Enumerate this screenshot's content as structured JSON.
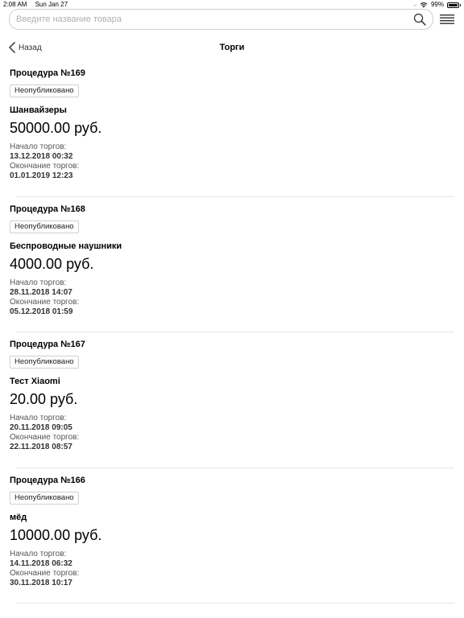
{
  "status_bar": {
    "time": "2:08 AM",
    "date": "Sun Jan 27",
    "battery": "99%",
    "signal": "....."
  },
  "search": {
    "placeholder": "Введите название товара"
  },
  "nav": {
    "back_label": "Назад",
    "title": "Торги"
  },
  "labels": {
    "start": "Начало торгов:",
    "end": "Окончание торгов:"
  },
  "procedures": [
    {
      "title": "Процедура №169",
      "status": "Неопубликовано",
      "product": "Шанвайзеры",
      "price": "50000.00 руб.",
      "start": "13.12.2018 00:32",
      "end": "01.01.2019 12:23"
    },
    {
      "title": "Процедура №168",
      "status": "Неопубликовано",
      "product": "Беспроводные наушники",
      "price": "4000.00 руб.",
      "start": "28.11.2018 14:07",
      "end": "05.12.2018 01:59"
    },
    {
      "title": "Процедура №167",
      "status": "Неопубликовано",
      "product": "Тест Xiaomi",
      "price": "20.00 руб.",
      "start": "20.11.2018 09:05",
      "end": "22.11.2018 08:57"
    },
    {
      "title": "Процедура №166",
      "status": "Неопубликовано",
      "product": "мёд",
      "price": "10000.00 руб.",
      "start": "14.11.2018 06:32",
      "end": "30.11.2018 10:17"
    }
  ]
}
